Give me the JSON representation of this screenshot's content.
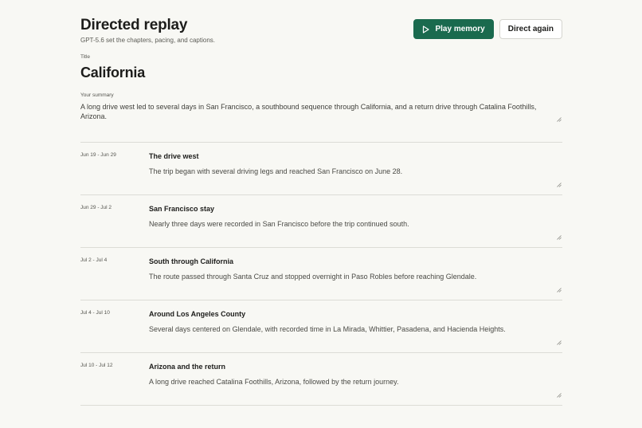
{
  "header": {
    "title": "Directed replay",
    "subtitle": "GPT-5.6 set the chapters, pacing, and captions.",
    "play_label": "Play memory",
    "direct_again_label": "Direct again"
  },
  "title_field": {
    "label": "Title",
    "value": "California"
  },
  "summary_field": {
    "label": "Your summary",
    "value": "A long drive west led to several days in San Francisco, a southbound sequence through California, and a return drive through Catalina Foothills, Arizona."
  },
  "chapters": [
    {
      "date": "Jun 19 - Jun 29",
      "title": "The drive west",
      "caption": "The trip began with several driving legs and reached San Francisco on June 28."
    },
    {
      "date": "Jun 29 - Jul 2",
      "title": "San Francisco stay",
      "caption": "Nearly three days were recorded in San Francisco before the trip continued south."
    },
    {
      "date": "Jul 2 - Jul 4",
      "title": "South through California",
      "caption": "The route passed through Santa Cruz and stopped overnight in Paso Robles before reaching Glendale."
    },
    {
      "date": "Jul 4 - Jul 10",
      "title": "Around Los Angeles County",
      "caption": "Several days centered on Glendale, with recorded time in La Mirada, Whittier, Pasadena, and Hacienda Heights."
    },
    {
      "date": "Jul 10 - Jul 12",
      "title": "Arizona and the return",
      "caption": "A long drive reached Catalina Foothills, Arizona, followed by the return journey."
    }
  ],
  "colors": {
    "accent": "#1a6a4e",
    "background": "#f8f8f4"
  }
}
